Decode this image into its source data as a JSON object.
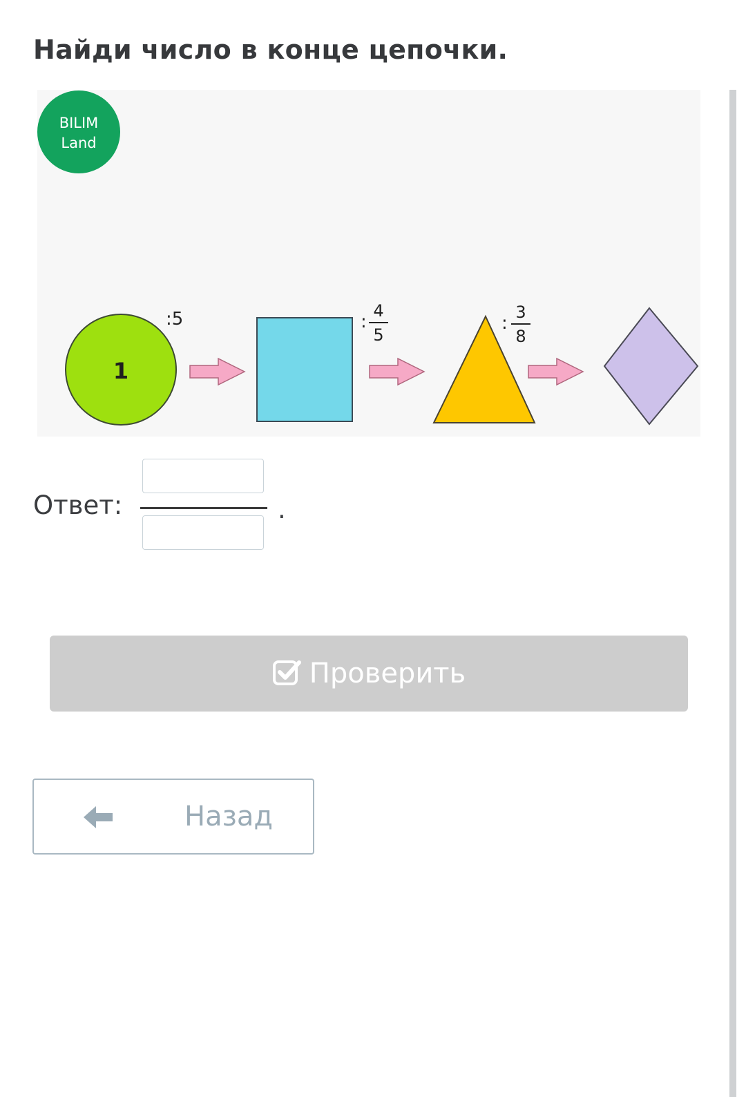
{
  "question": {
    "title": "Найди число в конце цепочки."
  },
  "figure": {
    "logo_line1": "BILIM",
    "logo_line2": "Land",
    "logo_color": "#13a35d",
    "start_value": "1",
    "op1": ":5",
    "op2_numerator": "4",
    "op2_denominator": "5",
    "op3_numerator": "3",
    "op3_denominator": "8",
    "colors": {
      "circle": "#9ee00f",
      "square": "#74d8ea",
      "triangle": "#fec700",
      "diamond": "#cdc1ea",
      "arrow": "#f6a9c6"
    }
  },
  "answer": {
    "label": "Ответ:",
    "numerator_value": "",
    "denominator_value": "",
    "trailing": "."
  },
  "buttons": {
    "check_label": "Проверить",
    "check_icon": "checkbox-check-icon",
    "back_label": "Назад",
    "back_icon": "arrow-left-icon"
  }
}
